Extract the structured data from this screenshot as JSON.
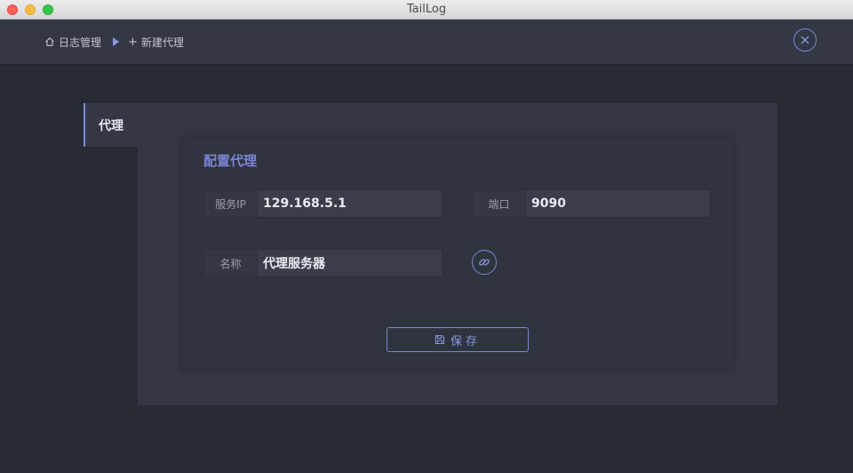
{
  "window": {
    "title": "TailLog"
  },
  "breadcrumb": {
    "home_icon": "home-icon",
    "home_label": "日志管理",
    "separator_icon": "caret-right-icon",
    "current_icon": "plus-icon",
    "current_label": "新建代理"
  },
  "header": {
    "close_icon": "close-circle-icon"
  },
  "tabs": [
    {
      "label": "代理",
      "active": true
    }
  ],
  "card": {
    "title": "配置代理",
    "fields": {
      "ip": {
        "label": "服务IP",
        "value": "129.168.5.1"
      },
      "port": {
        "label": "端口",
        "value": "9090"
      },
      "name": {
        "label": "名称",
        "value": "代理服务器"
      }
    },
    "link_icon": "link-icon",
    "save": {
      "icon": "save-icon",
      "label": "保存"
    }
  },
  "colors": {
    "accent": "#7b85d4",
    "background": "#282b34",
    "panel": "#343845",
    "card": "#30343f"
  }
}
